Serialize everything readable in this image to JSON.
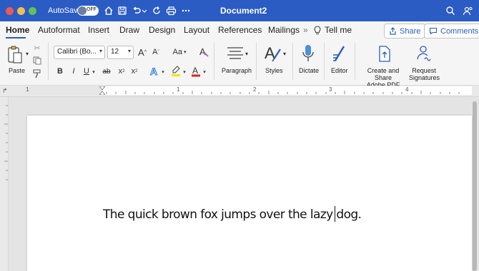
{
  "titlebar": {
    "autosave_label": "AutoSave",
    "autosave_toggle": "OFF",
    "doc_title": "Document2",
    "colors": {
      "bar": "#2a5cc4"
    }
  },
  "tabs": {
    "items": [
      {
        "label": "Home",
        "active": true
      },
      {
        "label": "Autoformat"
      },
      {
        "label": "Insert"
      },
      {
        "label": "Draw"
      },
      {
        "label": "Design"
      },
      {
        "label": "Layout"
      },
      {
        "label": "References"
      },
      {
        "label": "Mailings"
      },
      {
        "label": "Tell me"
      }
    ],
    "share_label": "Share",
    "comments_label": "Comments"
  },
  "ribbon": {
    "paste_label": "Paste",
    "font_name": "Calibri (Bo...",
    "font_size": "12",
    "aa_label": "Aa",
    "bold": "B",
    "italic": "I",
    "underline": "U",
    "strike": "ab",
    "subscript": "x",
    "superscript": "x",
    "paragraph_label": "Paragraph",
    "styles_label": "Styles",
    "dictate_label": "Dictate",
    "editor_label": "Editor",
    "create_share_label_1": "Create and Share",
    "create_share_label_2": "Adobe PDF",
    "request_sig_label_1": "Request",
    "request_sig_label_2": "Signatures",
    "icons": [
      "paste-icon",
      "cut-icon",
      "copy-icon",
      "format-painter-icon",
      "grow-font-icon",
      "shrink-font-icon",
      "clear-format-icon",
      "text-effects-icon",
      "highlighter-icon",
      "font-color-icon",
      "paragraph-icon",
      "styles-icon",
      "microphone-icon",
      "editor-icon",
      "adobe-pdf-icon",
      "request-signatures-icon"
    ]
  },
  "ruler": {
    "numbers": [
      "1",
      "1",
      "2",
      "3",
      "4"
    ]
  },
  "document": {
    "text": "The quick brown fox jumps over the lazy dog."
  }
}
